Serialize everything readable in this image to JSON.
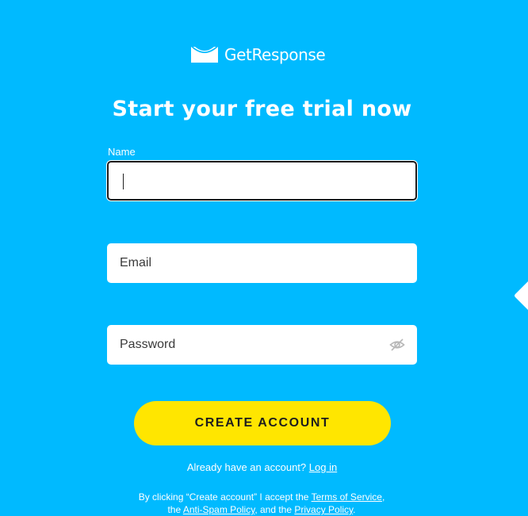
{
  "brand": {
    "name": "GetResponse"
  },
  "headline": "Start your free trial now",
  "form": {
    "name_label": "Name",
    "name_value": "",
    "email_placeholder": "Email",
    "password_placeholder": "Password"
  },
  "cta": {
    "label": "CREATE ACCOUNT"
  },
  "login": {
    "prompt": "Already have an account?",
    "link": "Log in"
  },
  "legal": {
    "text_1": "By clicking “Create account” I accept the",
    "terms_link": "Terms of Service",
    "text_2": ", the",
    "antispam_link": "Anti-Spam Policy",
    "text_3": ", and the",
    "privacy_link": "Privacy Policy",
    "text_4": "."
  },
  "icons": {
    "logo": "envelope-smile-icon",
    "password_toggle": "eye-slash-icon",
    "side_tab": "chevron-left-tab-icon"
  },
  "colors": {
    "background": "#00baff",
    "cta": "#ffe600",
    "text": "#ffffff"
  }
}
